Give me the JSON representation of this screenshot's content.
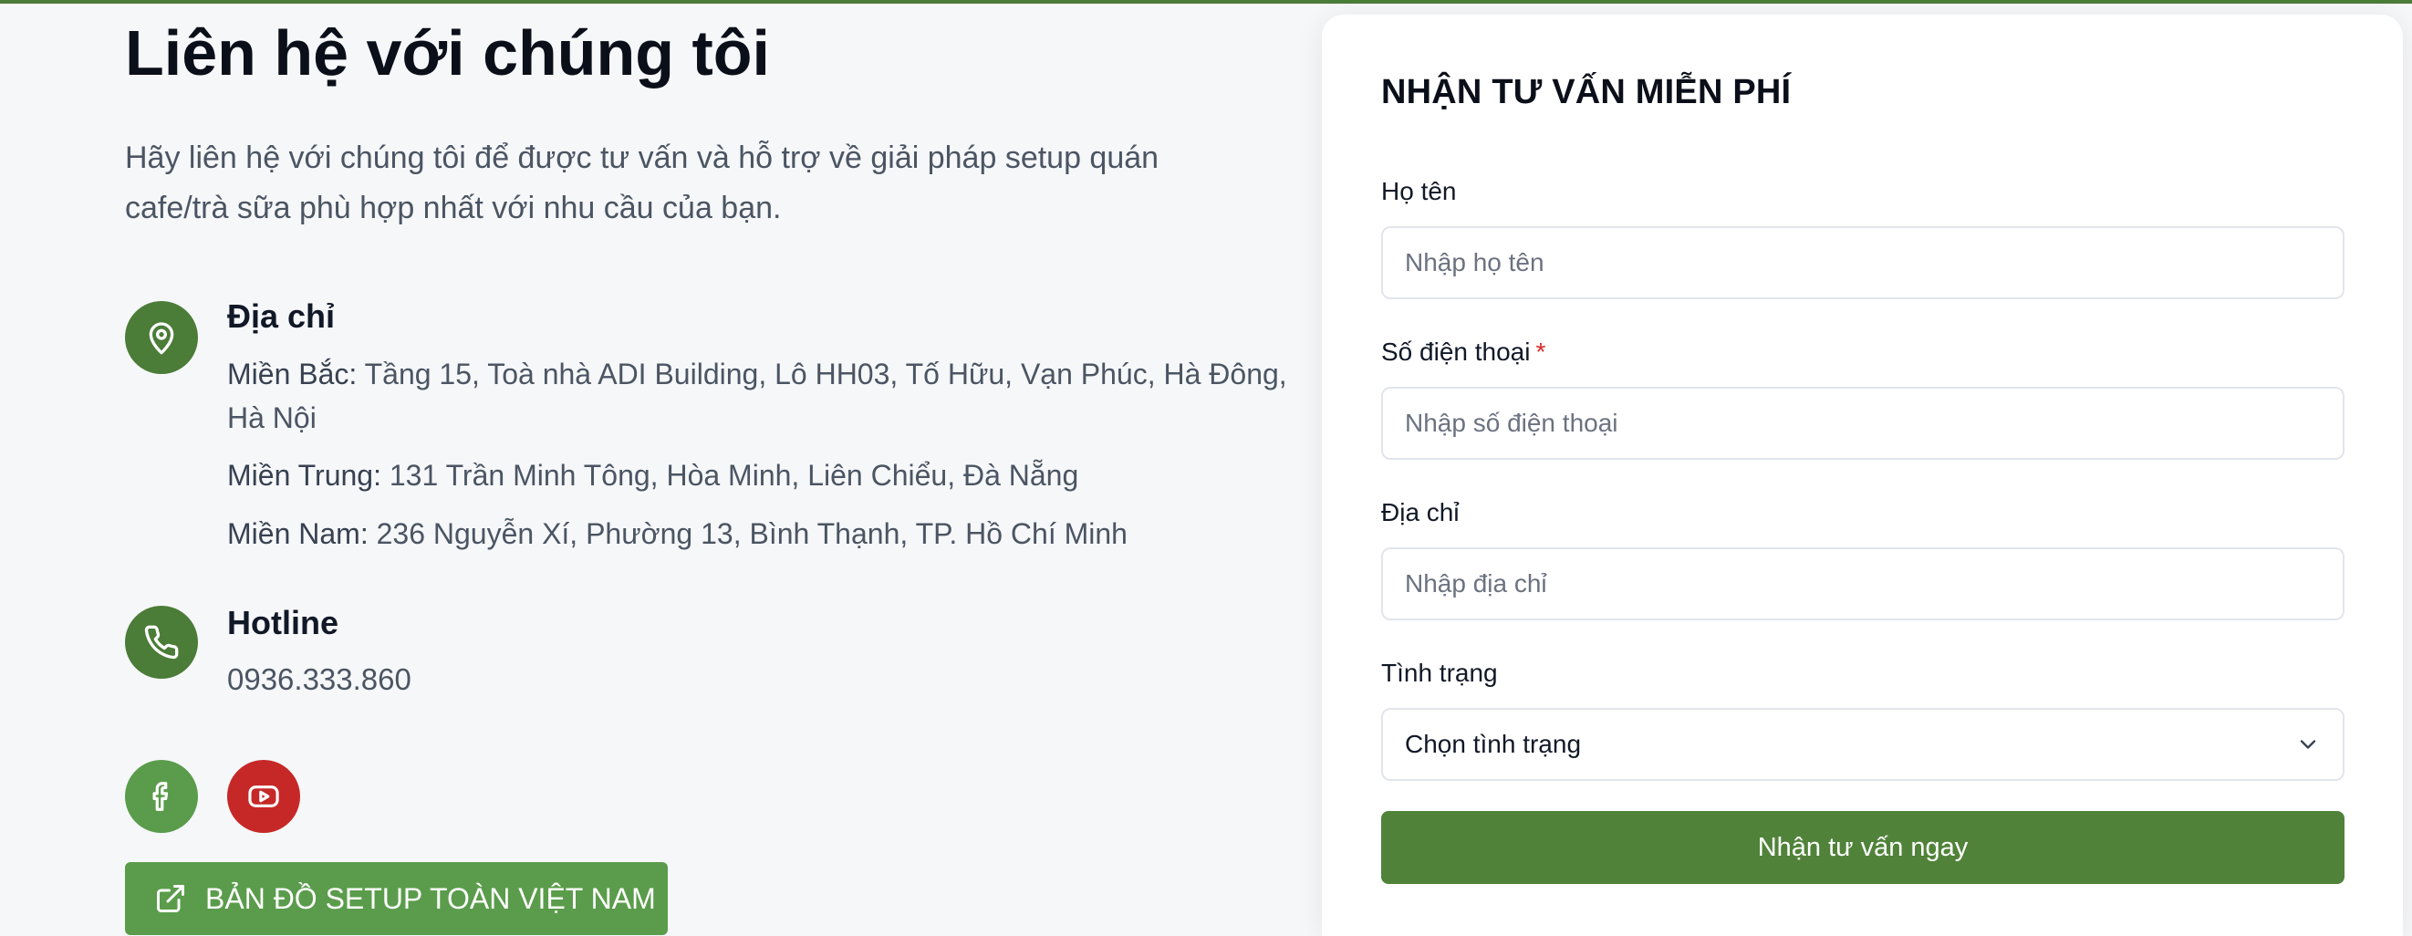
{
  "contact": {
    "title": "Liên hệ với chúng tôi",
    "intro": "Hãy liên hệ với chúng tôi để được tư vấn và hỗ trợ về giải pháp setup quán cafe/trà sữa phù hợp nhất với nhu cầu của bạn.",
    "address": {
      "title": "Địa chỉ",
      "icon": "map-pin-icon",
      "lines": [
        {
          "region": "Miền Bắc:",
          "text": "Tầng 15, Toà nhà ADI Building, Lô HH03, Tố Hữu, Vạn Phúc, Hà Đông, Hà Nội"
        },
        {
          "region": "Miền Trung:",
          "text": "131 Trần Minh Tông, Hòa Minh, Liên Chiểu, Đà Nẵng"
        },
        {
          "region": "Miền Nam:",
          "text": "236 Nguyễn Xí, Phường 13, Bình Thạnh, TP. Hồ Chí Minh"
        }
      ]
    },
    "hotline": {
      "title": "Hotline",
      "icon": "phone-icon",
      "value": "0936.333.860"
    },
    "social": [
      {
        "name": "facebook",
        "icon": "facebook-icon",
        "color": "#5a9c4b"
      },
      {
        "name": "youtube",
        "icon": "youtube-icon",
        "color": "#c62828"
      }
    ],
    "map_button": {
      "label": "BẢN ĐỒ SETUP TOÀN VIỆT NAM",
      "icon": "external-link-icon"
    }
  },
  "form": {
    "title": "NHẬN TƯ VẤN MIỄN PHÍ",
    "name": {
      "label": "Họ tên",
      "placeholder": "Nhập họ tên"
    },
    "phone": {
      "label": "Số điện thoại",
      "required_mark": "*",
      "placeholder": "Nhập số điện thoại"
    },
    "address": {
      "label": "Địa chỉ",
      "placeholder": "Nhập địa chỉ"
    },
    "status": {
      "label": "Tình trạng",
      "selected": "Chọn tình trạng",
      "icon": "chevron-down-icon"
    },
    "submit_label": "Nhận tư vấn ngay"
  },
  "colors": {
    "brand_green": "#4b7c38",
    "button_green": "#508339",
    "light_green": "#5a9c4b",
    "youtube_red": "#c62828",
    "required_red": "#dc2626"
  }
}
